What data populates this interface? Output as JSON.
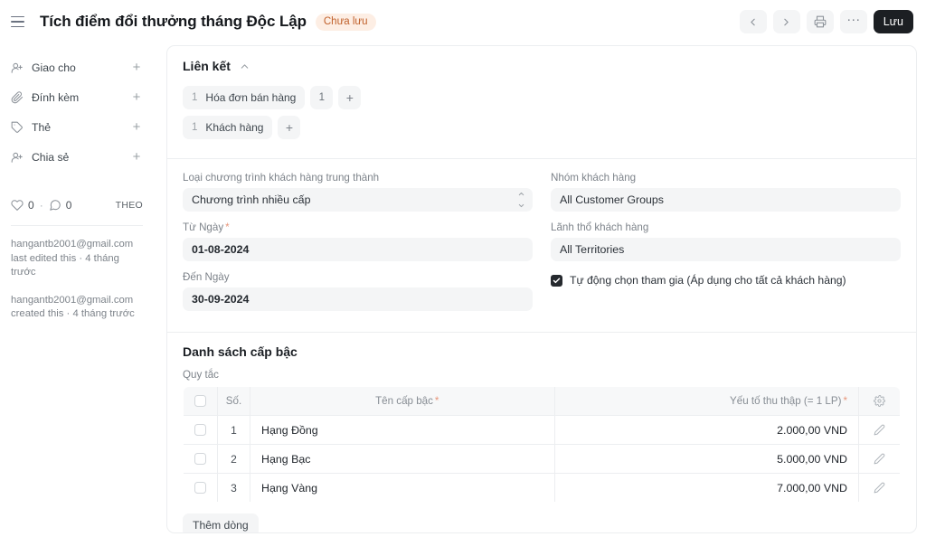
{
  "header": {
    "menu_icon": "hamburger-icon",
    "title": "Tích điểm đổi thưởng tháng Độc Lập",
    "status_badge": "Chưa lưu",
    "badge_bg": "#fdeee4",
    "badge_fg": "#c0602a",
    "prev_icon": "chevron-left-icon",
    "next_icon": "chevron-right-icon",
    "print_icon": "printer-icon",
    "more_icon": "ellipsis-icon",
    "more_label": "···",
    "save_label": "Lưu",
    "save_bg": "#1c1f23"
  },
  "sidebar": {
    "items": [
      {
        "label": "Giao cho",
        "icon": "assign-user-icon",
        "add": "+"
      },
      {
        "label": "Đính kèm",
        "icon": "paperclip-icon",
        "add": "+"
      },
      {
        "label": "Thẻ",
        "icon": "tag-icon",
        "add": "+"
      },
      {
        "label": "Chia sẻ",
        "icon": "share-user-icon",
        "add": "+"
      }
    ],
    "social": {
      "like_icon": "heart-icon",
      "like_count": "0",
      "separator": "·",
      "comment_icon": "comment-icon",
      "comment_count": "0",
      "follow_label": "THEO"
    },
    "activity": [
      {
        "user": "hangantb2001@gmail.com",
        "action": "last edited this · 4 tháng trước"
      },
      {
        "user": "hangantb2001@gmail.com",
        "action": "created this · 4 tháng trước"
      }
    ]
  },
  "links_section": {
    "title": "Liên kết",
    "collapse_icon": "chevron-up-icon",
    "rows": [
      {
        "count": "1",
        "label": "Hóa đơn bán hàng",
        "extra_badge": "1",
        "add": "+"
      },
      {
        "count": "1",
        "label": "Khách hàng",
        "extra_badge": null,
        "add": "+"
      }
    ]
  },
  "form": {
    "left": {
      "program_type_label": "Loại chương trình khách hàng trung thành",
      "program_type_value": "Chương trình nhiều cấp",
      "from_date_label": "Từ Ngày",
      "from_date_required": "*",
      "from_date_value": "01-08-2024",
      "to_date_label": "Đến Ngày",
      "to_date_value": "30-09-2024"
    },
    "right": {
      "customer_group_label": "Nhóm khách hàng",
      "customer_group_value": "All Customer Groups",
      "territory_label": "Lãnh thổ khách hàng",
      "territory_value": "All Territories",
      "auto_optin_label": "Tự động chọn tham gia (Áp dụng cho tất cả khách hàng)",
      "auto_optin_checked": true
    }
  },
  "tier_section": {
    "title": "Danh sách cấp bậc",
    "sublabel": "Quy tắc",
    "columns": {
      "no": "Số.",
      "name": "Tên cấp bậc",
      "name_required": "*",
      "collection_factor": "Yếu tố thu thập (= 1 LP)",
      "collection_factor_required": "*",
      "settings_icon": "gear-icon"
    },
    "rows": [
      {
        "no": "1",
        "name": "Hạng Đồng",
        "value": "2.000,00 VND",
        "edit_icon": "pencil-icon"
      },
      {
        "no": "2",
        "name": "Hạng Bạc",
        "value": "5.000,00 VND",
        "edit_icon": "pencil-icon"
      },
      {
        "no": "3",
        "name": "Hạng Vàng",
        "value": "7.000,00 VND",
        "edit_icon": "pencil-icon"
      }
    ],
    "add_row_label": "Thêm dòng"
  }
}
